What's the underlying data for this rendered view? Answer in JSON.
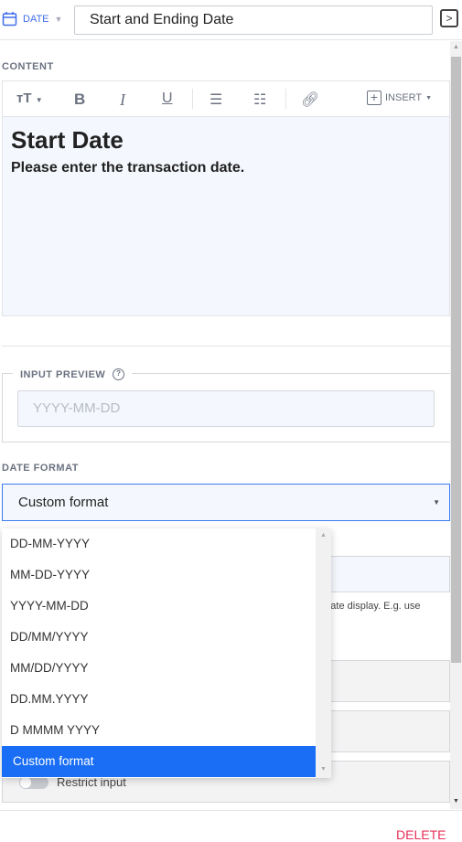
{
  "header": {
    "type_label": "DATE",
    "title_value": "Start and Ending Date",
    "next_icon": "chevron-right-icon"
  },
  "content": {
    "label": "CONTENT",
    "toolbar": {
      "insert_label": "INSERT"
    },
    "heading": "Start Date",
    "body": "Please enter the transaction date."
  },
  "input_preview": {
    "label": "INPUT PREVIEW",
    "placeholder": "YYYY-MM-DD"
  },
  "date_format": {
    "label": "DATE FORMAT",
    "selected": "Custom format",
    "options": [
      "DD-MM-YYYY",
      "MM-DD-YYYY",
      "YYYY-MM-DD",
      "DD/MM/YYYY",
      "MM/DD/YYYY",
      "DD.MM.YYYY",
      "D MMMM YYYY",
      "Custom format"
    ]
  },
  "hidden": {
    "helper_fragment": "e date display. E.g. use",
    "restrict_label": "Restrict input"
  },
  "footer": {
    "delete_label": "DELETE"
  },
  "colors": {
    "accent": "#1a6ef5",
    "delete": "#e8305a"
  }
}
